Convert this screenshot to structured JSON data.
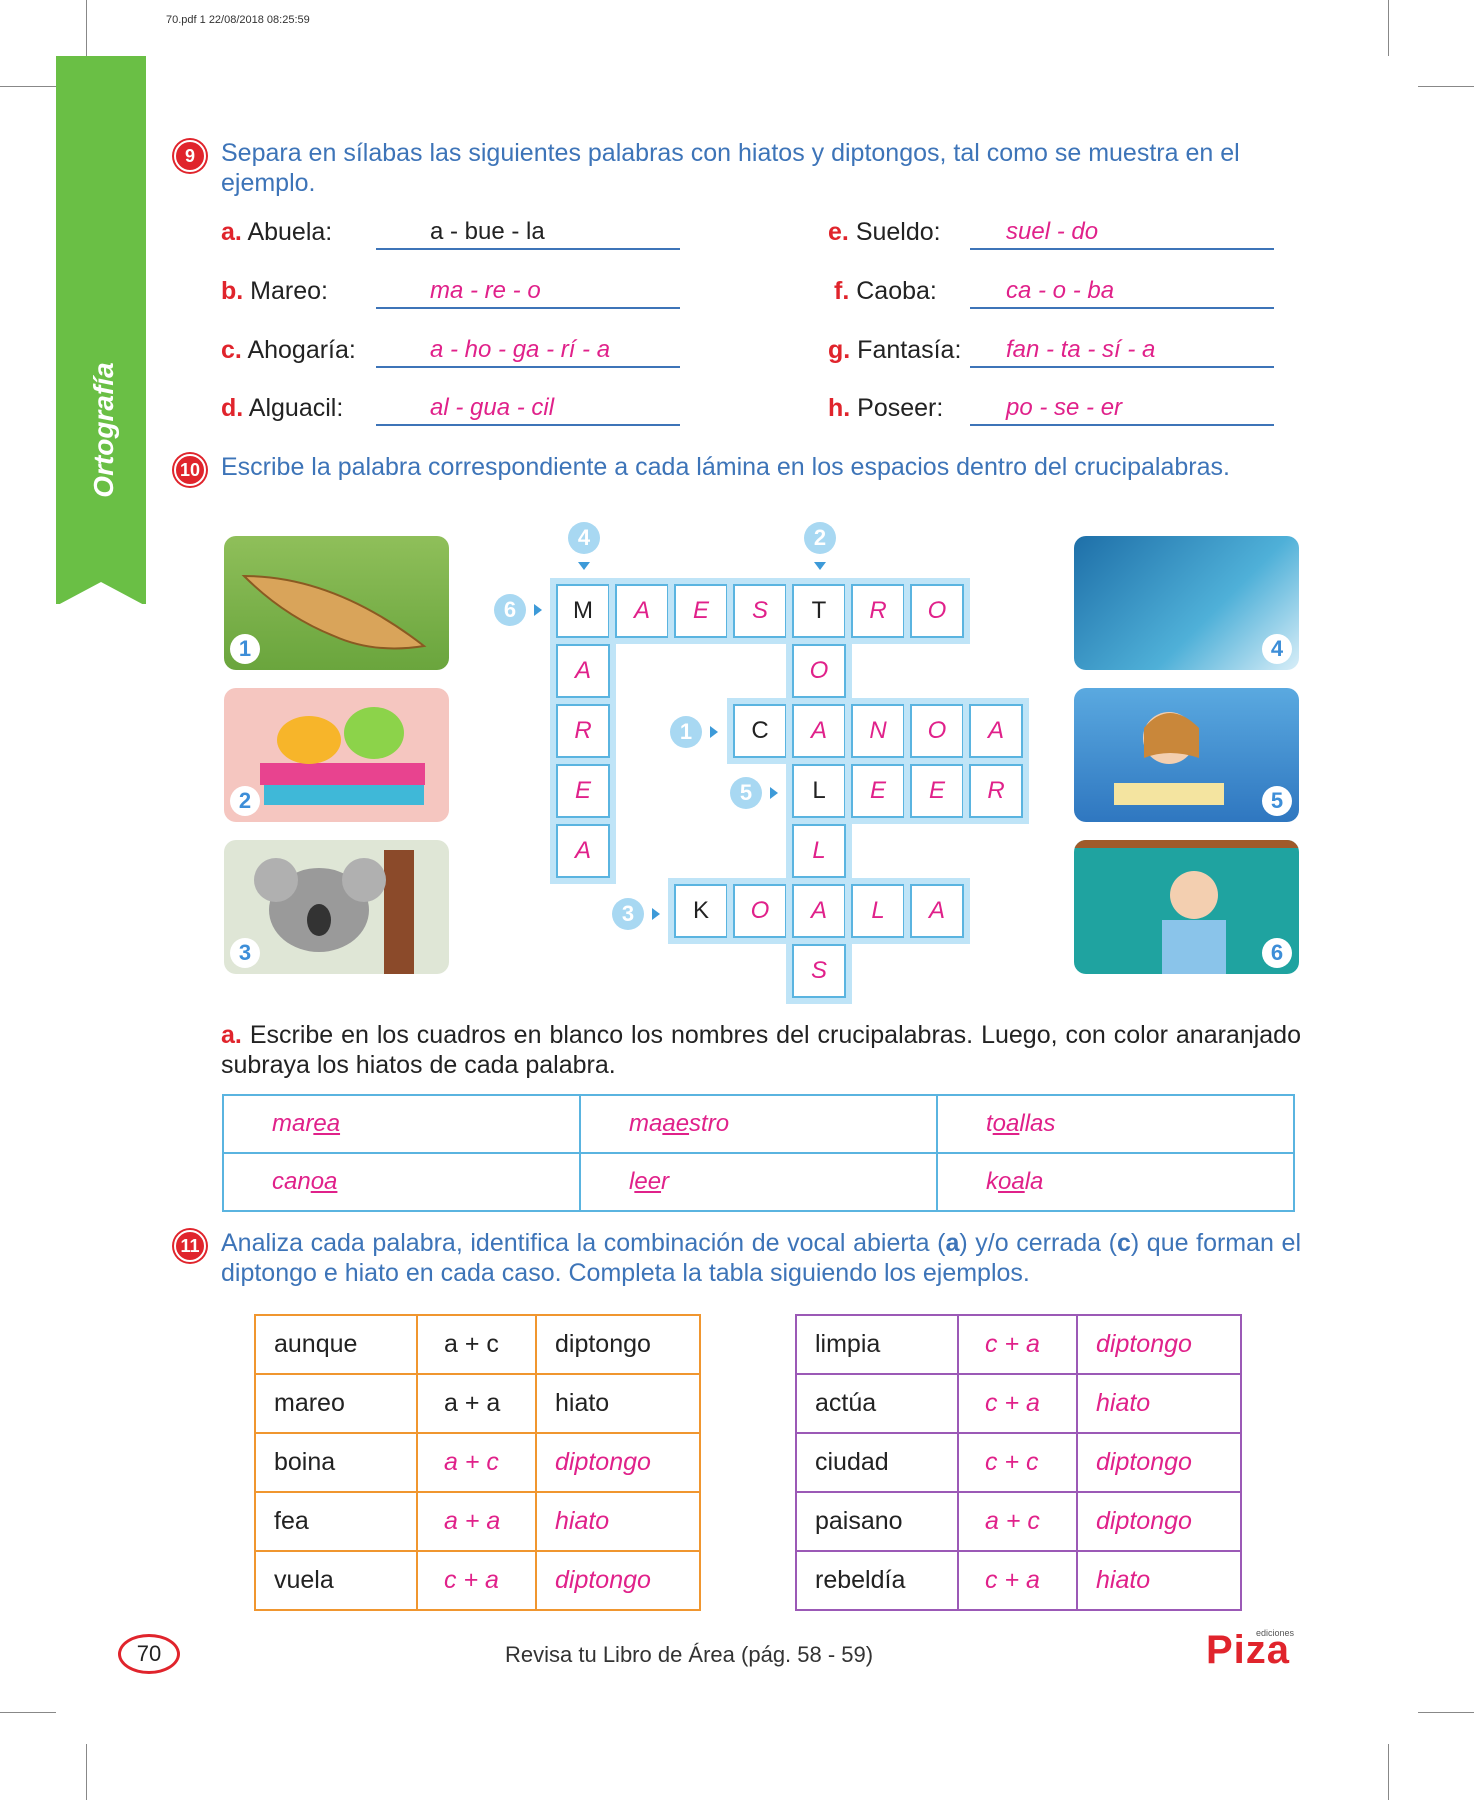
{
  "meta": "70.pdf   1   22/08/2018   08:25:59",
  "sidebar": "Ortografía",
  "ex9": {
    "num": "9",
    "instruction": "Separa en sílabas las siguientes palabras con hiatos y diptongos, tal como se muestra en el ejemplo.",
    "items": [
      {
        "letter": "a.",
        "word": "Abuela:",
        "answer": "a - bue - la"
      },
      {
        "letter": "b.",
        "word": "Mareo:",
        "answer": "ma - re - o"
      },
      {
        "letter": "c.",
        "word": "Ahogaría:",
        "answer": "a - ho - ga - rí - a"
      },
      {
        "letter": "d.",
        "word": "Alguacil:",
        "answer": "al - gua - cil"
      },
      {
        "letter": "e.",
        "word": "Sueldo:",
        "answer": "suel - do"
      },
      {
        "letter": "f.",
        "word": "Caoba:",
        "answer": "ca - o - ba"
      },
      {
        "letter": "g.",
        "word": "Fantasía:",
        "answer": "fan - ta - sí - a"
      },
      {
        "letter": "h.",
        "word": "Poseer:",
        "answer": "po - se - er"
      }
    ]
  },
  "ex10": {
    "num": "10",
    "instruction": "Escribe la palabra correspondiente a cada lámina en los espacios dentro del crucipalabras.",
    "photo_nums": [
      "1",
      "2",
      "3",
      "4",
      "5",
      "6"
    ],
    "clues": [
      "4",
      "2",
      "6",
      "1",
      "5",
      "3"
    ],
    "sub_a_letter": "a.",
    "sub_a": "Escribe en los cuadros en blanco los nombres del crucipalabras. Luego, con color anaranjado subraya los hiatos de cada palabra.",
    "hiatos": [
      [
        {
          "pre": "mar",
          "u": "ea",
          "post": ""
        },
        {
          "pre": "ma",
          "u": "ae",
          "post": "stro"
        },
        {
          "pre": "t",
          "u": "oa",
          "post": "llas"
        }
      ],
      [
        {
          "pre": "can",
          "u": "oa",
          "post": ""
        },
        {
          "pre": "l",
          "u": "ee",
          "post": "r"
        },
        {
          "pre": "k",
          "u": "oa",
          "post": "la"
        }
      ]
    ]
  },
  "crossword": {
    "cells": [
      {
        "c": "M",
        "given": true
      },
      {
        "c": "A"
      },
      {
        "c": "E"
      },
      {
        "c": "S"
      },
      {
        "c": "T",
        "given": true
      },
      {
        "c": "R"
      },
      {
        "c": "O"
      },
      {
        "c": "A"
      },
      {
        "c": "R"
      },
      {
        "c": "E"
      },
      {
        "c": "A"
      },
      {
        "c": "O"
      },
      {
        "c": "L"
      },
      {
        "c": "S"
      },
      {
        "c": "C",
        "given": true
      },
      {
        "c": "A"
      },
      {
        "c": "N"
      },
      {
        "c": "O"
      },
      {
        "c": "A"
      },
      {
        "c": "L",
        "given": true
      },
      {
        "c": "E"
      },
      {
        "c": "E"
      },
      {
        "c": "R"
      },
      {
        "c": "K",
        "given": true
      },
      {
        "c": "O"
      },
      {
        "c": "A"
      },
      {
        "c": "L"
      },
      {
        "c": "A"
      }
    ]
  },
  "ex11": {
    "num": "11",
    "instruction_parts": [
      "Analiza cada palabra, identifica la combinación de vocal abierta (",
      "a",
      ") y/o cerrada (",
      "c",
      ") que forman el diptongo e hiato en cada caso. Completa la tabla siguiendo los ejemplos."
    ],
    "left": [
      [
        "aunque",
        "a + c",
        "diptongo"
      ],
      [
        "mareo",
        "a + a",
        "hiato"
      ],
      [
        "boina",
        "a + c",
        "diptongo"
      ],
      [
        "fea",
        "a + a",
        "hiato"
      ],
      [
        "vuela",
        "c + a",
        "diptongo"
      ]
    ],
    "right": [
      [
        "limpia",
        "c + a",
        "diptongo"
      ],
      [
        "actúa",
        "c + a",
        "hiato"
      ],
      [
        "ciudad",
        "c + c",
        "diptongo"
      ],
      [
        "paisano",
        "a + c",
        "diptongo"
      ],
      [
        "rebeldía",
        "c + a",
        "hiato"
      ]
    ]
  },
  "footer": {
    "page": "70",
    "text": "Revisa tu Libro de Área (pág. 58 - 59)",
    "logo": "Piza",
    "logo_small": "ediciones"
  }
}
